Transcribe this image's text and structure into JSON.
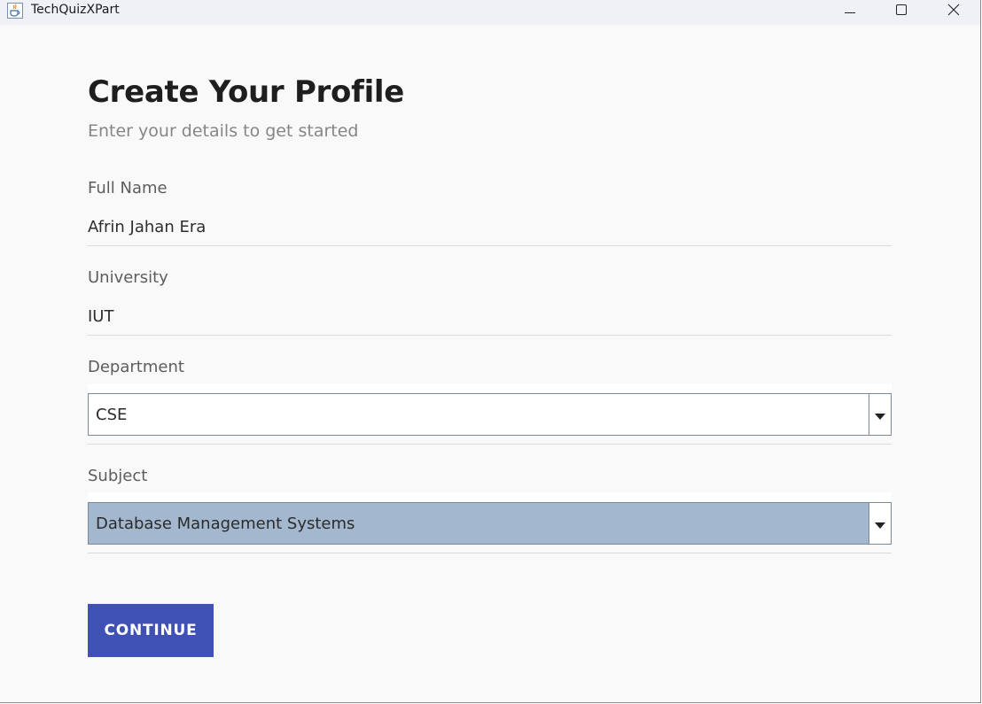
{
  "window": {
    "title": "TechQuizXPart",
    "icon": "java-cup-icon",
    "controls": [
      "minimize-icon",
      "maximize-icon",
      "close-icon"
    ]
  },
  "page": {
    "title": "Create Your Profile",
    "subtitle": "Enter your details to get started"
  },
  "form": {
    "full_name": {
      "label": "Full Name",
      "value": "Afrin Jahan Era"
    },
    "university": {
      "label": "University",
      "value": "IUT"
    },
    "department": {
      "label": "Department",
      "selected": "CSE"
    },
    "subject": {
      "label": "Subject",
      "selected": "Database Management Systems"
    },
    "continue_label": "CONTINUE"
  },
  "colors": {
    "button": "#3f51b5",
    "selected_combo": "#a3b8ce",
    "background": "#f9f9f9"
  }
}
